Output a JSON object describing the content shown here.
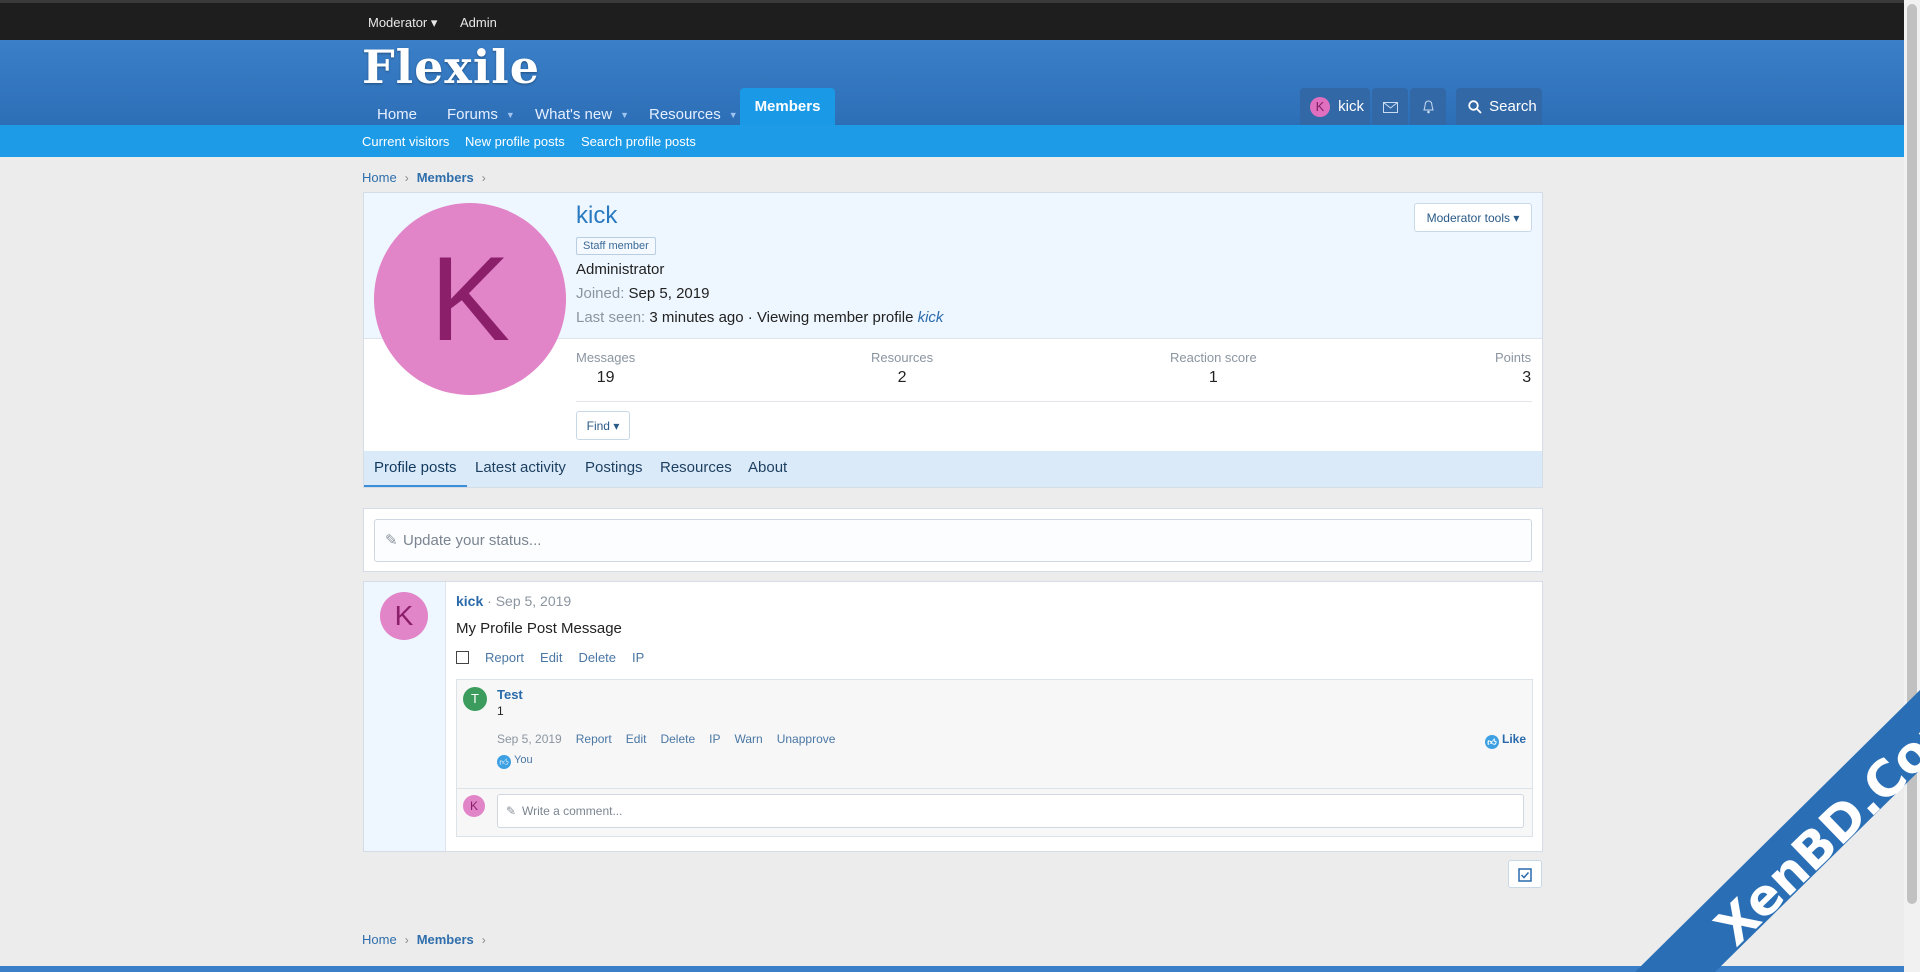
{
  "topbar": {
    "moderator": "Moderator ▾",
    "admin": "Admin"
  },
  "header": {
    "logo": "Flexile",
    "nav": {
      "home": "Home",
      "forums": "Forums",
      "whats_new": "What's new",
      "resources": "Resources",
      "members": "Members"
    },
    "user_initial": "K",
    "user_name": "kick",
    "search": "Search"
  },
  "subnav": {
    "current_visitors": "Current visitors",
    "new_profile_posts": "New profile posts",
    "search_profile_posts": "Search profile posts"
  },
  "breadcrumb": {
    "home": "Home",
    "members": "Members"
  },
  "profile": {
    "initial": "K",
    "name": "kick",
    "badge": "Staff member",
    "role": "Administrator",
    "joined_label": "Joined:",
    "joined": "Sep 5, 2019",
    "last_seen_label": "Last seen:",
    "last_seen": "3 minutes ago · Viewing member profile",
    "last_seen_user": "kick",
    "moderator_tools": "Moderator tools ▾",
    "stats": [
      {
        "label": "Messages",
        "value": "19"
      },
      {
        "label": "Resources",
        "value": "2"
      },
      {
        "label": "Reaction score",
        "value": "1"
      },
      {
        "label": "Points",
        "value": "3"
      }
    ],
    "find": "Find ▾",
    "tabs": [
      "Profile posts",
      "Latest activity",
      "Postings",
      "Resources",
      "About"
    ]
  },
  "status": {
    "placeholder": "Update your status..."
  },
  "post": {
    "initial": "K",
    "author": "kick",
    "date": " · Sep 5, 2019",
    "message": "My Profile Post Message",
    "actions": [
      "Report",
      "Edit",
      "Delete",
      "IP"
    ],
    "comment": {
      "initial": "T",
      "author": "Test",
      "text": "1",
      "date": "Sep 5, 2019",
      "actions": [
        "Report",
        "Edit",
        "Delete",
        "IP",
        "Warn",
        "Unapprove"
      ],
      "like": "Like",
      "liked_by": "You"
    },
    "write_initial": "K",
    "write_placeholder": "Write a comment..."
  },
  "watermark": "XenBD.Com",
  "colors": {
    "topbar": "#1e1e1e",
    "header": "#3a7fc8",
    "accent": "#1d9be7",
    "avatar": "#e184c8"
  }
}
